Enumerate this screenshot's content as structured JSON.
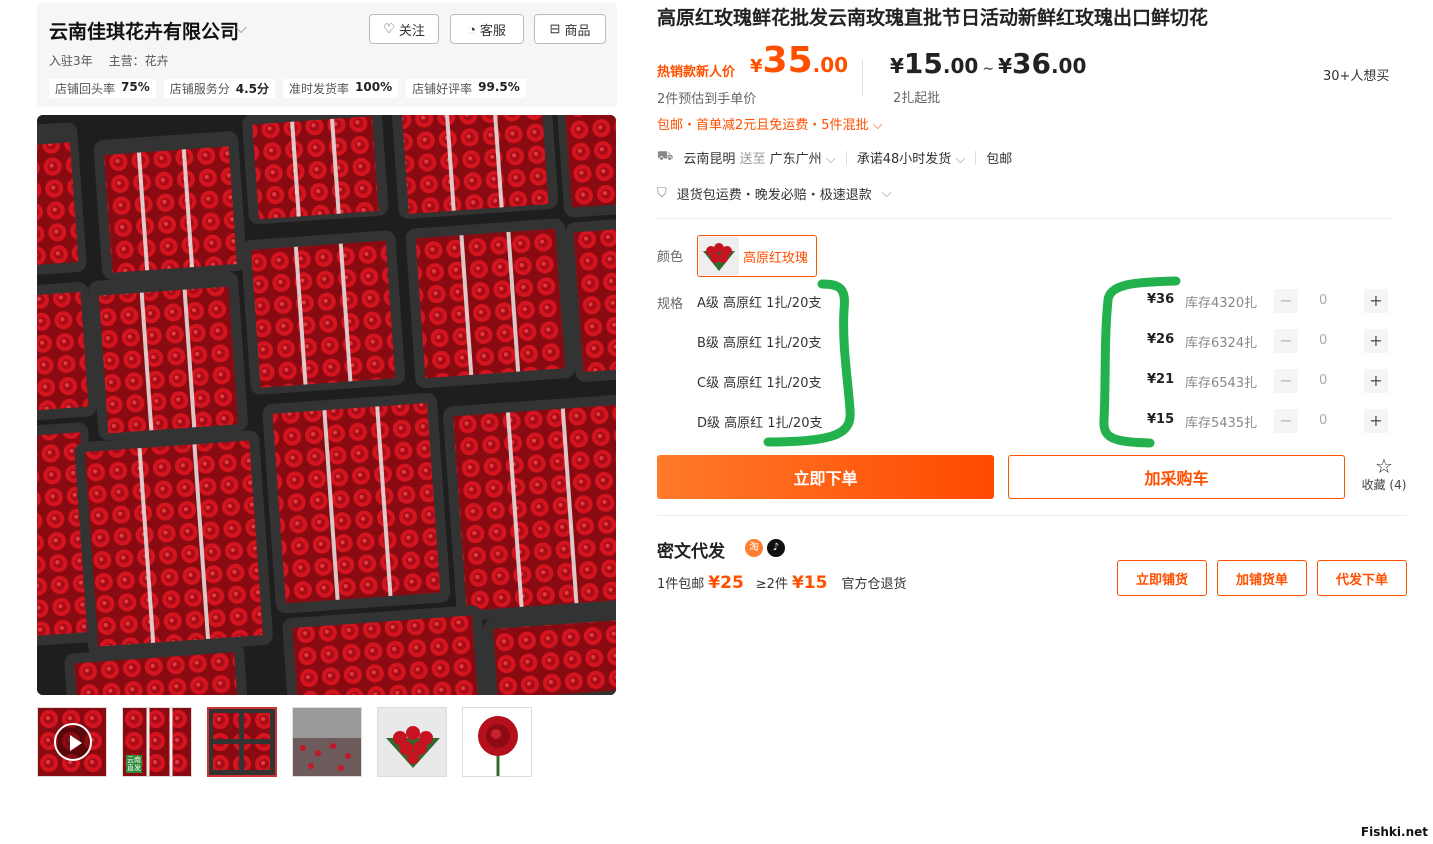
{
  "shop": {
    "name": "云南佳琪花卉有限公司",
    "follow": "关注",
    "service": "客服",
    "products": "商品",
    "joined": "入驻3年",
    "main_business": "主营：花卉",
    "stats": [
      {
        "label": "店铺回头率",
        "value": "75%"
      },
      {
        "label": "店铺服务分",
        "value": "4.5分"
      },
      {
        "label": "准时发货率",
        "value": "100%"
      },
      {
        "label": "店铺好评率",
        "value": "99.5%"
      }
    ]
  },
  "product": {
    "title": "高原红玫瑰鲜花批发云南玫瑰直批节日活动新鲜红玫瑰出口鲜切花",
    "promo_label": "热销款新人价",
    "promo_price": {
      "currency": "¥",
      "integer": "35",
      "decimal": ".00"
    },
    "promo_sub": "2件预估到手单价",
    "range_low": {
      "currency": "¥",
      "integer": "15",
      "decimal": ".00"
    },
    "range_tilde": "~",
    "range_high": {
      "currency": "¥",
      "integer": "36",
      "decimal": ".00"
    },
    "range_sub": "2扎起批",
    "wanted": "30+人想买",
    "shipping_promo": "包邮・首单减2元且免运费・5件混批",
    "origin": "云南昆明",
    "to_label": "送至",
    "destination": "广东广州",
    "dispatch": "承诺48小时发货",
    "free_shipping": "包邮",
    "guarantees": "退货包运费・晚发必赔・极速退款"
  },
  "options": {
    "color_label": "颜色",
    "color_value": "高原红玫瑰",
    "spec_label": "规格",
    "specs": [
      {
        "name": "A级 高原红 1扎/20支",
        "price": "¥36",
        "stock": "库存4320扎",
        "qty": "0"
      },
      {
        "name": "B级 高原红 1扎/20支",
        "price": "¥26",
        "stock": "库存6324扎",
        "qty": "0"
      },
      {
        "name": "C级 高原红 1扎/20支",
        "price": "¥21",
        "stock": "库存6543扎",
        "qty": "0"
      },
      {
        "name": "D级 高原红 1扎/20支",
        "price": "¥15",
        "stock": "库存5435扎",
        "qty": "0"
      }
    ],
    "minus": "−",
    "plus": "+"
  },
  "actions": {
    "buy_now": "立即下单",
    "add_cart": "加采购车",
    "favorite": "收藏 (4)"
  },
  "distribution": {
    "title": "密文代发",
    "badge_taobao": "淘",
    "row_prefix1": "1件包邮",
    "price1": "¥25",
    "row_prefix2": "≥2件",
    "price2": "¥15",
    "row_suffix": "官方仓退货",
    "btn_stock": "立即铺货",
    "btn_add": "加铺货单",
    "btn_order": "代发下单"
  },
  "colors": {
    "accent": "#ff5000",
    "annotation_green": "#22b14c"
  },
  "icons": {
    "follow": "heart-icon",
    "service": "headset-icon",
    "products": "store-icon",
    "truck": "truck-icon",
    "shield": "shield-icon",
    "star": "star-icon",
    "play": "play-icon"
  },
  "watermark": "Fishki.net"
}
